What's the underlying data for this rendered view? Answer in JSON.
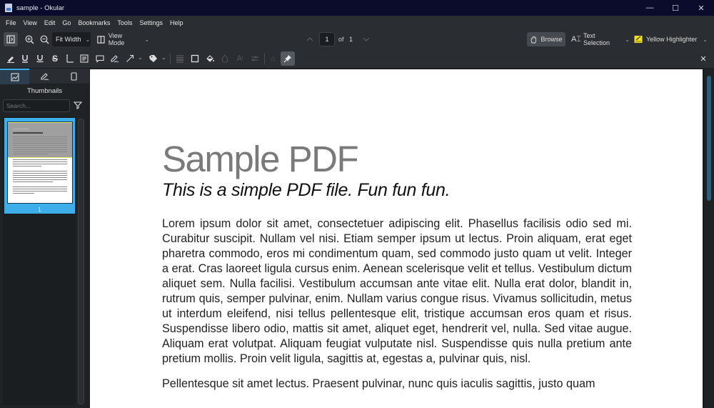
{
  "window": {
    "title": "sample  - Okular",
    "controls": {
      "minimize": "—",
      "maximize": "☐",
      "close": "✕"
    }
  },
  "menubar": {
    "items": [
      "File",
      "View",
      "Edit",
      "Go",
      "Bookmarks",
      "Tools",
      "Settings",
      "Help"
    ]
  },
  "toolbar": {
    "zoom_mode": "Fit Width",
    "view_mode_label": "View Mode",
    "current_page": "1",
    "of_label": "of",
    "total_pages": "1",
    "browse_label": "Browse",
    "text_selection_label": "Text Selection",
    "highlighter_label": "Yellow Highlighter"
  },
  "annotation_toolbar": {
    "tools": [
      "highlighter",
      "underline",
      "squiggle",
      "strike-out",
      "typewriter",
      "inline-note",
      "popup-note",
      "freehand-line",
      "arrow",
      "stamp",
      "line-width",
      "border",
      "fill-color",
      "opacity",
      "font",
      "annotation-settings",
      "add-to-quick-tools",
      "pin"
    ]
  },
  "sidebar": {
    "tabs": [
      "thumbnails",
      "annotations",
      "bookmarks"
    ],
    "title": "Thumbnails",
    "search_placeholder": "Search...",
    "thumbnails": [
      {
        "page_label": "1",
        "selected": true
      }
    ]
  },
  "document": {
    "title": "Sample PDF",
    "subtitle": "This is a simple PDF file. Fun fun fun.",
    "paragraphs": [
      "Lorem ipsum dolor sit amet, consectetuer adipiscing elit. Phasellus facilisis odio sed mi. Curabitur suscipit. Nullam vel nisi. Etiam semper ipsum ut lectus. Proin aliquam, erat eget pharetra commodo, eros mi condimentum quam, sed commodo justo quam ut velit. Integer a erat. Cras laoreet ligula cursus enim. Aenean scelerisque velit et tellus. Vestibulum dictum aliquet sem. Nulla facilisi. Vestibulum accumsan ante vitae elit. Nulla erat dolor, blandit in, rutrum quis, semper pulvinar, enim. Nullam varius congue risus. Vivamus sollicitudin, metus ut interdum eleifend, nisi tellus pellentesque elit, tristique accumsan eros quam et risus. Suspendisse libero odio, mattis sit amet, aliquet eget, hendrerit vel, nulla. Sed vitae augue. Aliquam erat volutpat. Aliquam feugiat vulputate nisl. Suspendisse quis nulla pretium ante pretium mollis. Proin velit ligula, sagittis at, egestas a, pulvinar quis, nisl.",
      "Pellentesque sit amet lectus. Praesent pulvinar, nunc quis iaculis sagittis, justo quam"
    ]
  },
  "colors": {
    "accent": "#3daee9",
    "titlebar": "#0b0c2c",
    "toolbar": "#2a2e32",
    "highlighter": "#f0e020"
  }
}
